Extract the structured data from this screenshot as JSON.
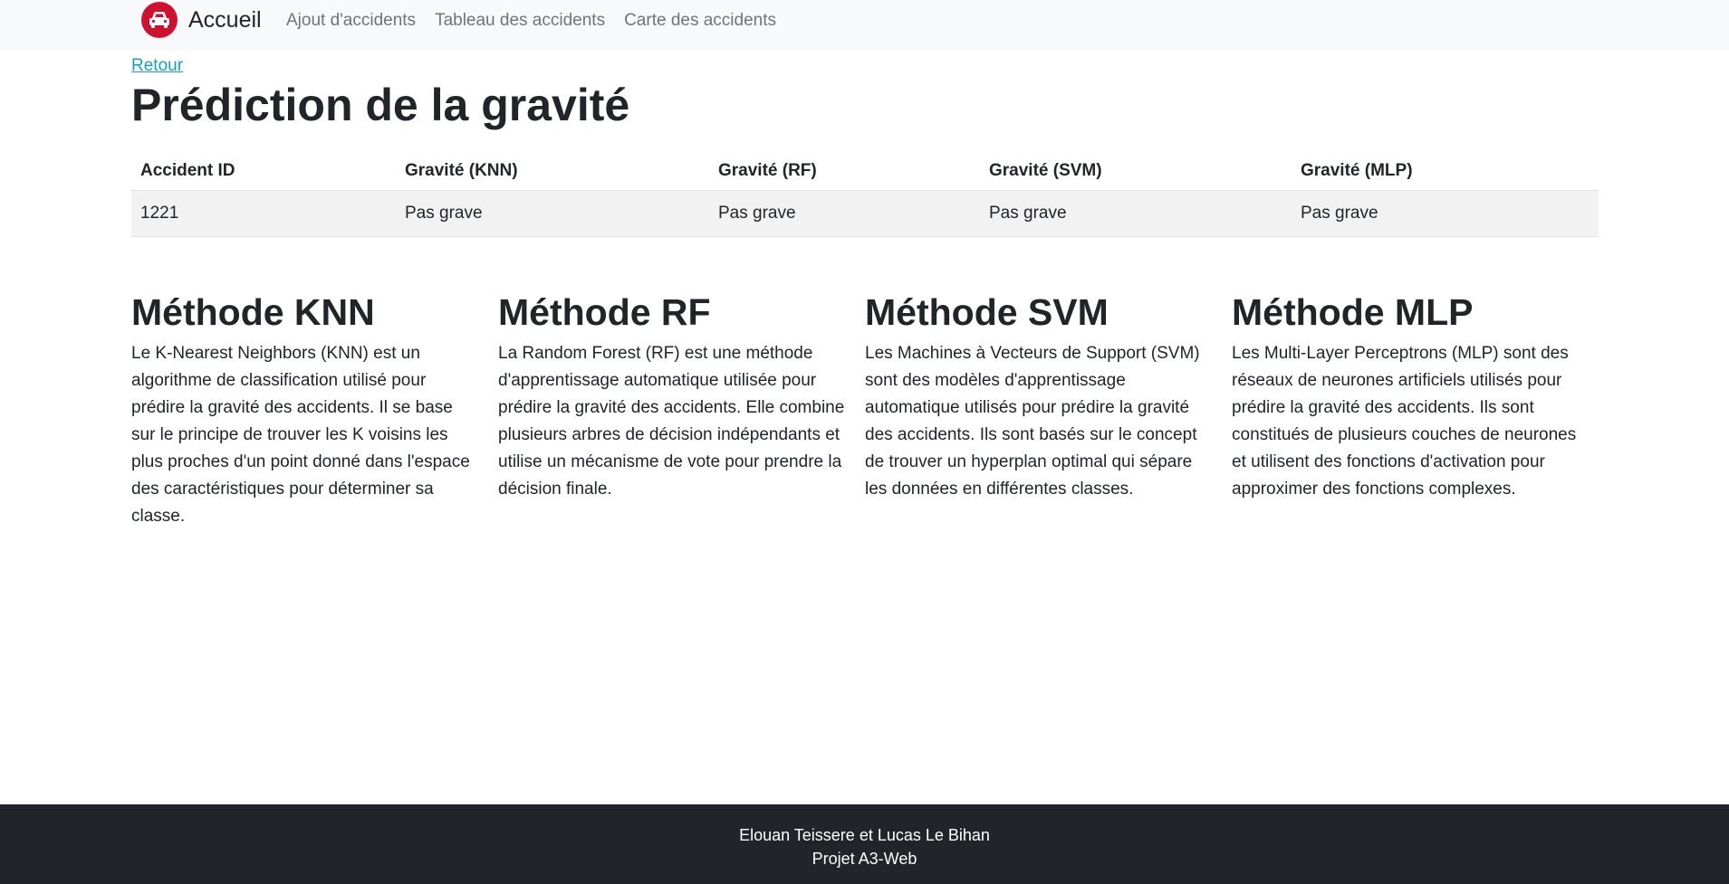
{
  "navbar": {
    "brand_label": "Accueil",
    "brand_icon": "car-icon",
    "brand_color": "#d0102f",
    "links": [
      {
        "label": "Ajout d'accidents"
      },
      {
        "label": "Tableau des accidents"
      },
      {
        "label": "Carte des accidents"
      }
    ]
  },
  "main": {
    "back_link": "Retour",
    "title": "Prédiction de la gravité",
    "table": {
      "headers": [
        "Accident ID",
        "Gravité (KNN)",
        "Gravité (RF)",
        "Gravité (SVM)",
        "Gravité (MLP)"
      ],
      "rows": [
        [
          "1221",
          "Pas grave",
          "Pas grave",
          "Pas grave",
          "Pas grave"
        ]
      ]
    },
    "methods": [
      {
        "title": "Méthode KNN",
        "text": "Le K-Nearest Neighbors (KNN) est un algorithme de classification utilisé pour prédire la gravité des accidents. Il se base sur le principe de trouver les K voisins les plus proches d'un point donné dans l'espace des caractéristiques pour déterminer sa classe."
      },
      {
        "title": "Méthode RF",
        "text": "La Random Forest (RF) est une méthode d'apprentissage automatique utilisée pour prédire la gravité des accidents. Elle combine plusieurs arbres de décision indépendants et utilise un mécanisme de vote pour prendre la décision finale."
      },
      {
        "title": "Méthode SVM",
        "text": "Les Machines à Vecteurs de Support (SVM) sont des modèles d'apprentissage automatique utilisés pour prédire la gravité des accidents. Ils sont basés sur le concept de trouver un hyperplan optimal qui sépare les données en différentes classes."
      },
      {
        "title": "Méthode MLP",
        "text": "Les Multi-Layer Perceptrons (MLP) sont des réseaux de neurones artificiels utilisés pour prédire la gravité des accidents. Ils sont constitués de plusieurs couches de neurones et utilisent des fonctions d'activation pour approximer des fonctions complexes."
      }
    ]
  },
  "footer": {
    "authors": "Elouan Teissere et Lucas Le Bihan",
    "project": "Projet A3-Web"
  },
  "colors": {
    "navbar_bg": "#f8f9fa",
    "link": "#17a2b8",
    "footer_bg": "#212529"
  }
}
